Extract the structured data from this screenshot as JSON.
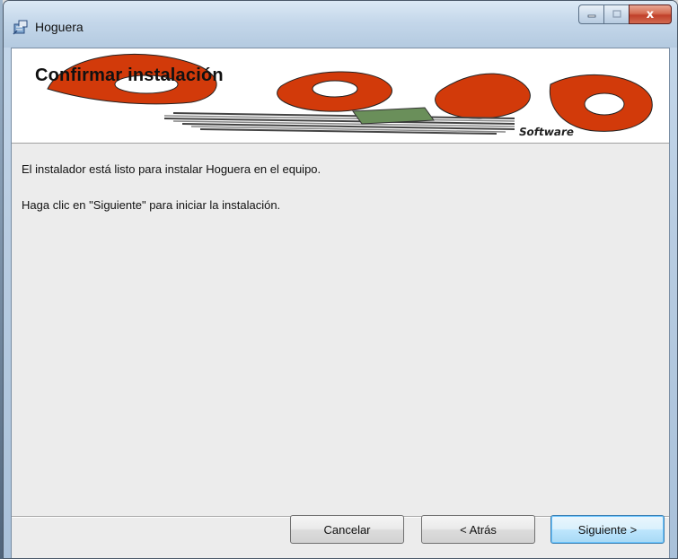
{
  "window": {
    "title": "Hoguera",
    "close_glyph": "x",
    "caption_icons": [
      "minimize-icon",
      "maximize-icon",
      "close-icon"
    ]
  },
  "banner": {
    "title": "Confirmar instalación",
    "logo_text": "Software"
  },
  "content": {
    "line1": "El instalador está listo para instalar Hoguera en el equipo.",
    "line2": "Haga clic en \"Siguiente\" para iniciar la instalación."
  },
  "buttons": {
    "cancel": "Cancelar",
    "back": "< Atrás",
    "next": "Siguiente >"
  },
  "colors": {
    "logo_red": "#d23a0a",
    "default_button_border": "#3c7fb1"
  }
}
